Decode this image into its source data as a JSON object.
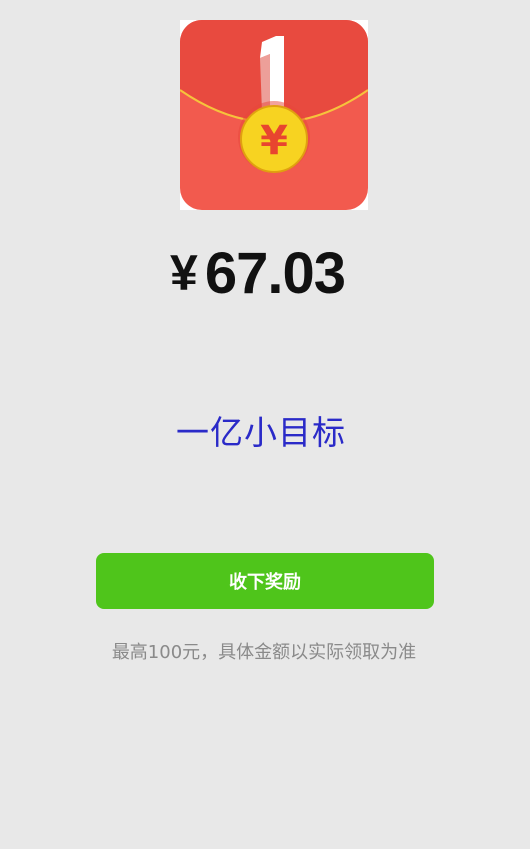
{
  "envelope": {
    "number_label": "1",
    "coin_symbol": "¥",
    "colors": {
      "envelope_top": "#e84a3f",
      "envelope_bottom": "#f25a4e",
      "flap_line": "#f6c33c",
      "coin": "#f7d321",
      "coin_text": "#e8452f"
    }
  },
  "reward": {
    "currency": "¥",
    "amount": "67.03"
  },
  "goal": {
    "title": "一亿小目标"
  },
  "claim_button": {
    "label": "收下奖励",
    "color": "#4fc51b"
  },
  "disclaimer": "最高100元，具体金额以实际领取为准"
}
